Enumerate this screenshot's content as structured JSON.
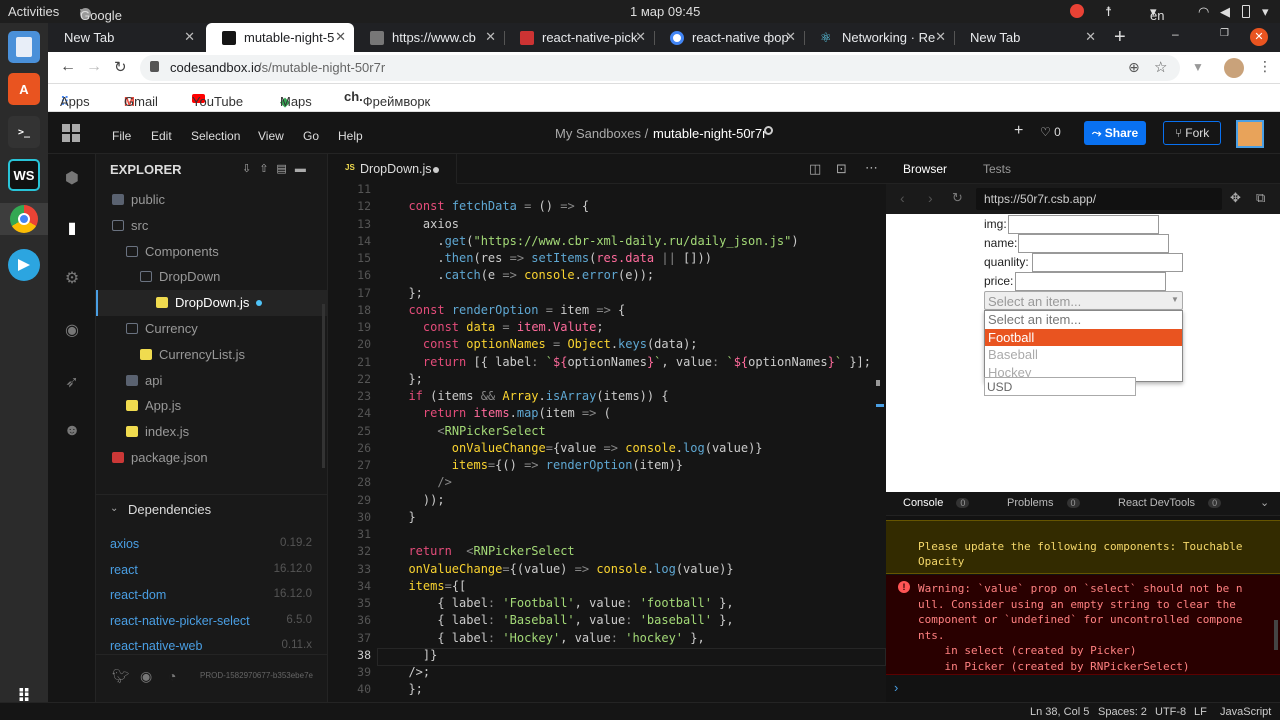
{
  "system": {
    "activities": "Activities",
    "app_name": "Google Chrome",
    "clock": "1 мар  09:45",
    "lang": "en"
  },
  "dock": [
    {
      "name": "files-icon",
      "label": ""
    },
    {
      "name": "store-icon",
      "label": "A"
    },
    {
      "name": "terminal-icon",
      "label": ">_"
    },
    {
      "name": "webstorm-icon",
      "label": "WS"
    },
    {
      "name": "chrome-icon",
      "label": ""
    },
    {
      "name": "telegram-icon",
      "label": ""
    },
    {
      "name": "grid-icon",
      "label": ""
    }
  ],
  "tabs": [
    {
      "title": "New Tab",
      "active": false,
      "color": "#202124"
    },
    {
      "title": "mutable-night-5",
      "active": true,
      "color": "#151515"
    },
    {
      "title": "https://www.cb",
      "active": false,
      "color": "#777"
    },
    {
      "title": "react-native-pick",
      "active": false,
      "color": "#cc3333"
    },
    {
      "title": "react-native фор",
      "active": false,
      "color": "#4285f4"
    },
    {
      "title": "Networking · Re",
      "active": false,
      "color": "#61dafb"
    },
    {
      "title": "New Tab",
      "active": false,
      "color": "#202124"
    }
  ],
  "address": {
    "url_host": "codesandbox.io",
    "url_path": "/s/mutable-night-50r7r"
  },
  "bookmarks": [
    {
      "label": "Apps",
      "color": "#4285f4"
    },
    {
      "label": "Gmail",
      "color": "#ea4335"
    },
    {
      "label": "YouTube",
      "color": "#ff0000"
    },
    {
      "label": "Maps",
      "color": "#34a853"
    },
    {
      "label": "Фреймворк V...",
      "color": "#222",
      "prefix": "ch."
    }
  ],
  "menu": [
    "File",
    "Edit",
    "Selection",
    "View",
    "Go",
    "Help"
  ],
  "breadcrumb": {
    "parent": "My Sandboxes /",
    "current": "mutable-night-50r7r"
  },
  "header_actions": {
    "likes": "0",
    "share": "Share",
    "fork": "Fork"
  },
  "explorer": {
    "title": "EXPLORER",
    "items": [
      {
        "label": "public",
        "indent": 0,
        "type": "folder"
      },
      {
        "label": "src",
        "indent": 0,
        "type": "folder-open"
      },
      {
        "label": "Components",
        "indent": 1,
        "type": "folder-open"
      },
      {
        "label": "DropDown",
        "indent": 2,
        "type": "folder-open"
      },
      {
        "label": "DropDown.js",
        "indent": 3,
        "type": "js",
        "active": true
      },
      {
        "label": "Currency",
        "indent": 1,
        "type": "folder-open"
      },
      {
        "label": "CurrencyList.js",
        "indent": 2,
        "type": "js"
      },
      {
        "label": "api",
        "indent": 1,
        "type": "folder"
      },
      {
        "label": "App.js",
        "indent": 1,
        "type": "js"
      },
      {
        "label": "index.js",
        "indent": 1,
        "type": "js"
      },
      {
        "label": "package.json",
        "indent": 0,
        "type": "json"
      }
    ],
    "deps_title": "Dependencies",
    "dependencies": [
      {
        "name": "axios",
        "version": "0.19.2"
      },
      {
        "name": "react",
        "version": "16.12.0"
      },
      {
        "name": "react-dom",
        "version": "16.12.0"
      },
      {
        "name": "react-native-picker-select",
        "version": "6.5.0"
      },
      {
        "name": "react-native-web",
        "version": "0.11.x"
      }
    ],
    "footer_id": "PROD-1582970677-b353ebe7e"
  },
  "editor": {
    "tab_label": "DropDown.js",
    "js_badge": "JS",
    "lines": [
      {
        "n": "11",
        "html": ""
      },
      {
        "n": "12",
        "html": "  <span class='k'>const</span> <span class='f'>fetchData</span> <span class='o'>=</span> () <span class='o'>=&gt;</span> {"
      },
      {
        "n": "13",
        "html": "    axios"
      },
      {
        "n": "14",
        "html": "      .<span class='f'>get</span>(<span class='g'>\"https://www.cbr-xml-daily.ru/daily_json.js\"</span>)"
      },
      {
        "n": "15",
        "html": "      .<span class='f'>then</span>(res <span class='o'>=&gt;</span> <span class='f'>setItems</span>(<span class='r'>res.data</span> <span class='o'>||</span> []))"
      },
      {
        "n": "16",
        "html": "      .<span class='f'>catch</span>(e <span class='o'>=&gt;</span> <span class='y'>console</span>.<span class='f'>error</span>(e));"
      },
      {
        "n": "17",
        "html": "  };"
      },
      {
        "n": "18",
        "html": "  <span class='k'>const</span> <span class='f'>renderOption</span> <span class='o'>=</span> item <span class='o'>=&gt;</span> {"
      },
      {
        "n": "19",
        "html": "    <span class='k'>const</span> <span class='y'>data</span> <span class='o'>=</span> <span class='r'>item.Valute</span>;"
      },
      {
        "n": "20",
        "html": "    <span class='k'>const</span> <span class='y'>optionNames</span> <span class='o'>=</span> <span class='y'>Object</span>.<span class='f'>keys</span>(data);"
      },
      {
        "n": "21",
        "html": "    <span class='k'>return</span> [{ label<span class='o'>:</span> <span class='g'>`</span><span class='r'>${</span>optionNames<span class='r'>}</span><span class='g'>`</span>, value<span class='o'>:</span> <span class='g'>`</span><span class='r'>${</span>optionNames<span class='r'>}</span><span class='g'>`</span> }];"
      },
      {
        "n": "22",
        "html": "  };"
      },
      {
        "n": "23",
        "html": "  <span class='k'>if</span> (items <span class='o'>&amp;&amp;</span> <span class='y'>Array</span>.<span class='f'>isArray</span>(items)) {"
      },
      {
        "n": "24",
        "html": "    <span class='k'>return</span> <span class='r'>items</span>.<span class='f'>map</span>(item <span class='o'>=&gt;</span> ("
      },
      {
        "n": "25",
        "html": "      <span class='o'>&lt;</span><span class='g'>RNPickerSelect</span>"
      },
      {
        "n": "26",
        "html": "        <span class='y'>onValueChange</span><span class='o'>=</span>{value <span class='o'>=&gt;</span> <span class='y'>console</span>.<span class='f'>log</span>(value)}"
      },
      {
        "n": "27",
        "html": "        <span class='y'>items</span><span class='o'>=</span>{() <span class='o'>=&gt;</span> <span class='f'>renderOption</span>(item)}"
      },
      {
        "n": "28",
        "html": "      <span class='o'>/&gt;</span>"
      },
      {
        "n": "29",
        "html": "    ));"
      },
      {
        "n": "30",
        "html": "  }"
      },
      {
        "n": "31",
        "html": ""
      },
      {
        "n": "32",
        "html": "  <span class='k'>return</span>  <span class='o'>&lt;</span><span class='g'>RNPickerSelect</span>"
      },
      {
        "n": "33",
        "html": "  <span class='y'>onValueChange</span><span class='o'>=</span>{(value) <span class='o'>=&gt;</span> <span class='y'>console</span>.<span class='f'>log</span>(value)}"
      },
      {
        "n": "34",
        "html": "  <span class='y'>items</span><span class='o'>=</span>{["
      },
      {
        "n": "35",
        "html": "      { label<span class='o'>:</span> <span class='g'>'Football'</span>, value<span class='o'>:</span> <span class='g'>'football'</span> },"
      },
      {
        "n": "36",
        "html": "      { label<span class='o'>:</span> <span class='g'>'Baseball'</span>, value<span class='o'>:</span> <span class='g'>'baseball'</span> },"
      },
      {
        "n": "37",
        "html": "      { label<span class='o'>:</span> <span class='g'>'Hockey'</span>, value<span class='o'>:</span> <span class='g'>'hockey'</span> },"
      },
      {
        "n": "38",
        "html": "    ]}"
      },
      {
        "n": "39",
        "html": "  /&gt;;"
      },
      {
        "n": "40",
        "html": "  };"
      }
    ]
  },
  "right_panel": {
    "tabs": [
      "Browser",
      "Tests"
    ],
    "preview_url": "https://50r7r.csb.app/",
    "form": [
      {
        "label": "img:"
      },
      {
        "label": "name:"
      },
      {
        "label": "quanlity:"
      },
      {
        "label": "price:"
      }
    ],
    "select_placeholder": "Select an item...",
    "dropdown_options": [
      "Select an item...",
      "Football",
      "Baseball",
      "Hockey"
    ],
    "selected_option": "Football",
    "currency_value": "USD",
    "console_tabs": [
      {
        "label": "Console",
        "count": "0"
      },
      {
        "label": "Problems",
        "count": "0"
      },
      {
        "label": "React DevTools",
        "count": "0"
      }
    ],
    "warning_text": "Please update the following components: Touchable Opacity",
    "error_lines": [
      "Warning: `value` prop on `select` should not be n",
      "ull. Consider using an empty string to clear the",
      "component or `undefined` for uncontrolled compone",
      "nts.",
      "    in select (created by Picker)",
      "    in Picker (created by RNPickerSelect)"
    ],
    "prompt": "›"
  },
  "status": {
    "position": "Ln 38, Col 5",
    "spaces": "Spaces: 2",
    "encoding": "UTF-8",
    "eol": "LF",
    "language": "JavaScript"
  }
}
